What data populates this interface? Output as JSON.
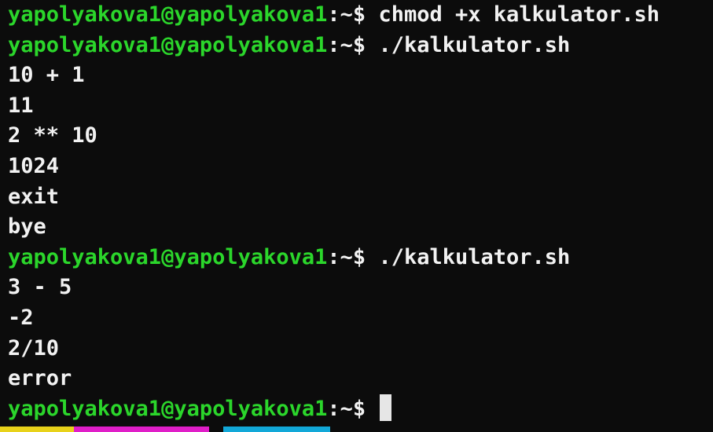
{
  "colors": {
    "background": "#0c0c0c",
    "prompt": "#2bd62b",
    "text": "#f2f2f2",
    "status_yellow": "#e8d21a",
    "status_magenta": "#e01ec8",
    "status_cyan": "#12a8d8"
  },
  "prompt": {
    "user_host": "yapolyakova1@yapolyakova1",
    "separator": ":~$"
  },
  "lines": [
    {
      "type": "command",
      "text": "chmod +x kalkulator.sh"
    },
    {
      "type": "command",
      "text": "./kalkulator.sh"
    },
    {
      "type": "output",
      "text": "10 + 1"
    },
    {
      "type": "output",
      "text": "11"
    },
    {
      "type": "output",
      "text": "2 ** 10"
    },
    {
      "type": "output",
      "text": "1024"
    },
    {
      "type": "output",
      "text": "exit"
    },
    {
      "type": "output",
      "text": "bye"
    },
    {
      "type": "command",
      "text": "./kalkulator.sh"
    },
    {
      "type": "output",
      "text": "3 - 5"
    },
    {
      "type": "output",
      "text": "-2"
    },
    {
      "type": "output",
      "text": "2/10"
    },
    {
      "type": "output",
      "text": "error"
    },
    {
      "type": "command",
      "text": ""
    }
  ]
}
